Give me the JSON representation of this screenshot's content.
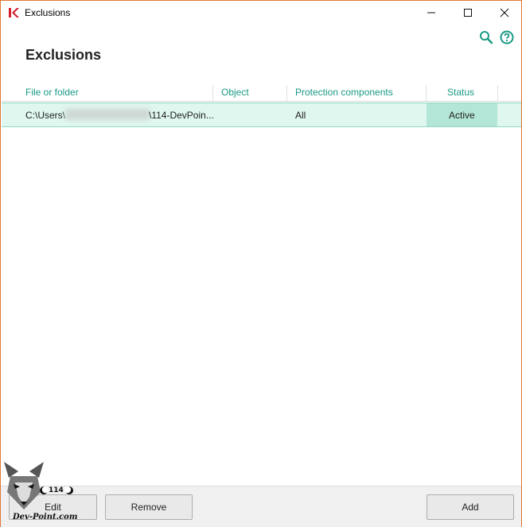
{
  "window": {
    "title": "Exclusions",
    "controls": [
      "minimize",
      "maximize",
      "close"
    ]
  },
  "toolbar": {
    "icons": [
      "search-icon",
      "help-icon"
    ],
    "accent_color": "#1a9a85"
  },
  "page": {
    "title": "Exclusions"
  },
  "table": {
    "columns": [
      "File or folder",
      "Object",
      "Protection components",
      "Status"
    ],
    "rows": [
      {
        "file_prefix": "C:\\Users\\",
        "file_suffix": "\\114-DevPoin...",
        "object": "",
        "components": "All",
        "status": "Active"
      }
    ],
    "selected_row_color": "#dff7ef",
    "status_cell_color": "#b3e6d6"
  },
  "buttons": {
    "edit": "Edit",
    "remove": "Remove",
    "add": "Add"
  },
  "watermark": {
    "number": "114",
    "site": "Dev-Point.com"
  }
}
